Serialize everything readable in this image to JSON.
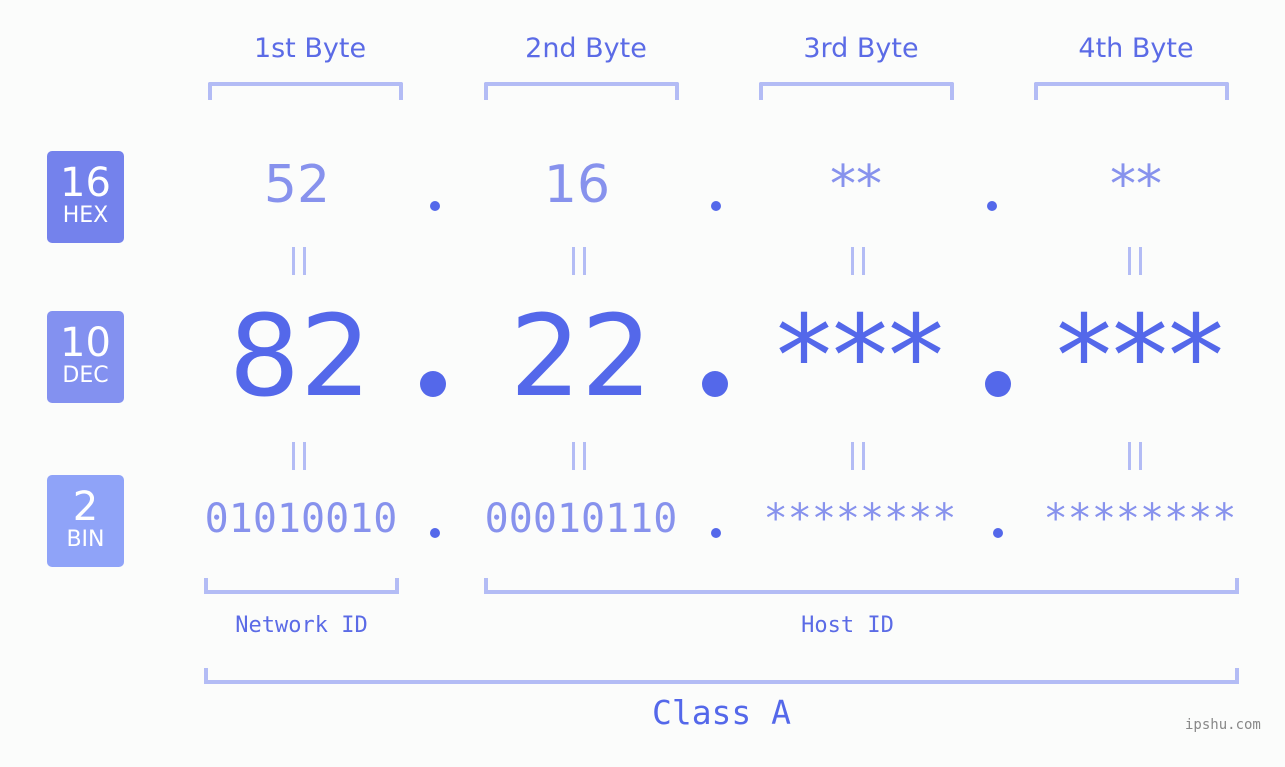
{
  "headers": [
    "1st Byte",
    "2nd Byte",
    "3rd Byte",
    "4th Byte"
  ],
  "badges": {
    "hex": {
      "num": "16",
      "label": "HEX",
      "color": "#7482ec"
    },
    "dec": {
      "num": "10",
      "label": "DEC",
      "color": "#8391f0"
    },
    "bin": {
      "num": "2",
      "label": "BIN",
      "color": "#8fa3f8"
    }
  },
  "hex": [
    "52",
    "16",
    "**",
    "**"
  ],
  "dec": [
    "82",
    "22",
    "***",
    "***"
  ],
  "bin": [
    "01010010",
    "00010110",
    "********",
    "********"
  ],
  "separator": ".",
  "equals": "=",
  "network_label": "Network ID",
  "host_label": "Host ID",
  "class_label": "Class A",
  "watermark": "ipshu.com",
  "colors": {
    "accent": "#5468ea",
    "light": "#8792ed",
    "bracket": "#b3bcf5"
  }
}
